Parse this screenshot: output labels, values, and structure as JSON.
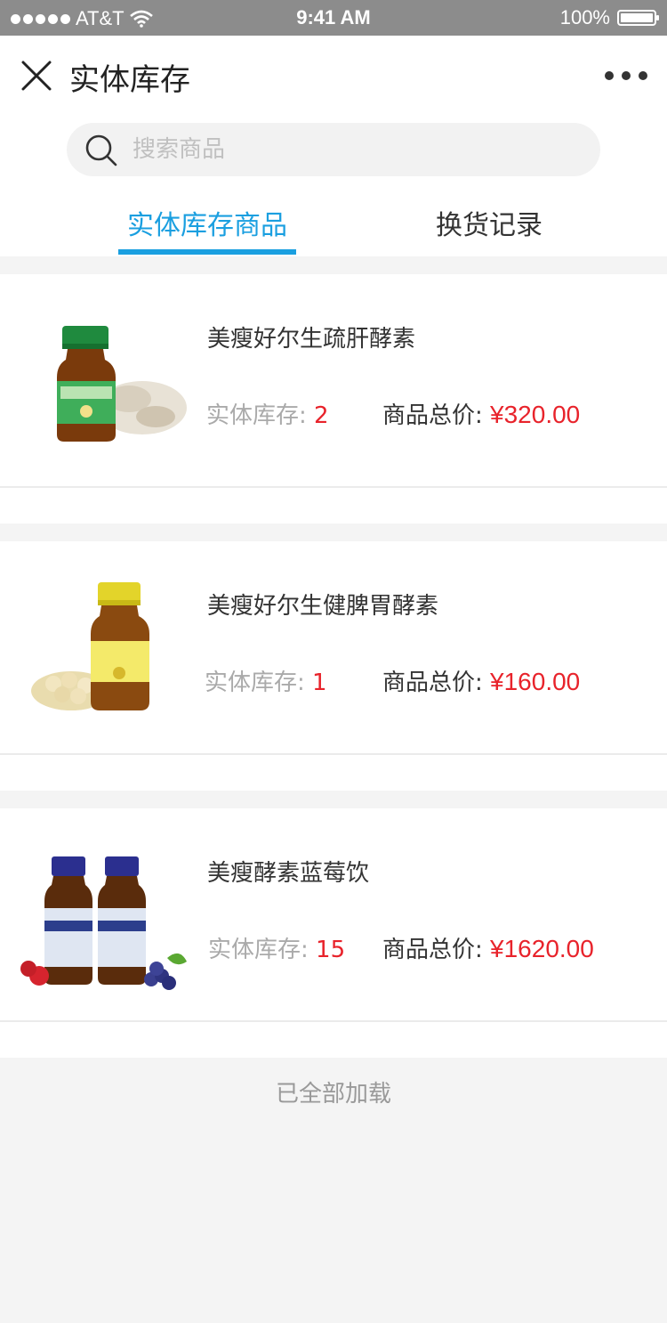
{
  "status_bar": {
    "carrier": "AT&T",
    "time": "9:41 AM",
    "battery": "100%"
  },
  "header": {
    "title": "实体库存"
  },
  "search": {
    "placeholder": "搜索商品"
  },
  "tabs": [
    {
      "label": "实体库存商品",
      "active": true
    },
    {
      "label": "换货记录",
      "active": false
    }
  ],
  "colors": {
    "accent": "#1a9fe0",
    "price": "#e8232b"
  },
  "products": [
    {
      "name": "美瘦好尔生疏肝酵素",
      "stock_label": "实体库存: ",
      "stock": "2",
      "total_label": "商品总价: ",
      "price": "¥320.00",
      "image_icon": "green-cap-bottle-image"
    },
    {
      "name": "美瘦好尔生健脾胃酵素",
      "stock_label": "实体库存: ",
      "stock": "1",
      "total_label": "商品总价: ",
      "price": "¥160.00",
      "image_icon": "yellow-cap-bottle-image"
    },
    {
      "name": "美瘦酵素蓝莓饮",
      "stock_label": "实体库存: ",
      "stock": "15",
      "total_label": "商品总价: ",
      "price": "¥1620.00",
      "image_icon": "blueberry-bottles-image"
    }
  ],
  "footer": {
    "text": "已全部加载"
  }
}
